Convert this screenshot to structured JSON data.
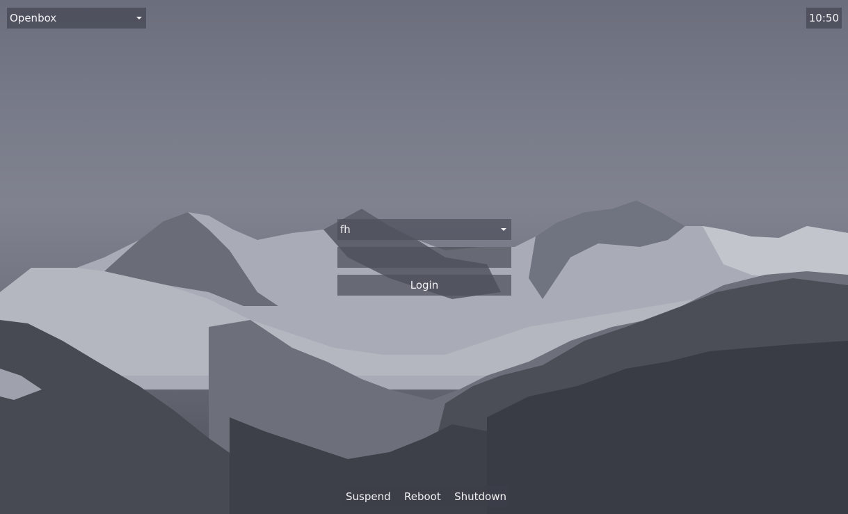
{
  "session": {
    "selected": "Openbox"
  },
  "clock": {
    "time": "10:50"
  },
  "login": {
    "user": "fh",
    "password_value": "",
    "button_label": "Login"
  },
  "power": {
    "suspend_label": "Suspend",
    "reboot_label": "Reboot",
    "shutdown_label": "Shutdown"
  },
  "icons": {
    "session_dropdown": "chevron-down-icon",
    "user_dropdown": "chevron-down-icon"
  },
  "colors": {
    "text": "#f2f2f4",
    "panel": "#4e505c",
    "sky": "#777a88"
  }
}
